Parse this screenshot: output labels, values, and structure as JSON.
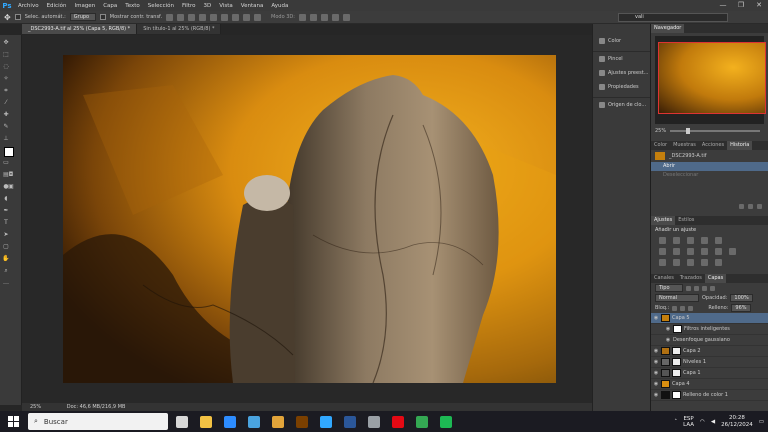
{
  "app": {
    "logo": "Ps"
  },
  "menu": [
    "Archivo",
    "Edición",
    "Imagen",
    "Capa",
    "Texto",
    "Selección",
    "Filtro",
    "3D",
    "Vista",
    "Ventana",
    "Ayuda"
  ],
  "window_controls": {
    "minimize": "—",
    "maximize": "❐",
    "close": "✕"
  },
  "options_bar": {
    "auto_select_label": "Selec. automát.:",
    "auto_select_value": "Grupo",
    "transform_label": "Mostrar contr. transf.",
    "mode3d_label": "Modo 3D:",
    "search_value": "vali"
  },
  "doc_tabs": [
    {
      "label": "_DSC2993-A.tif al 25% (Capa 5, RGB/8) *",
      "active": true
    },
    {
      "label": "Sin título-1 al 25% (RGB/8) *",
      "active": false
    }
  ],
  "mid_panel": [
    {
      "icon": "color-cube-icon",
      "label": "Color"
    },
    {
      "icon": "brush-icon",
      "label": "Pincel"
    },
    {
      "icon": "brush-presets-icon",
      "label": "Ajustes preest..."
    },
    {
      "icon": "properties-icon",
      "label": "Propiedades"
    },
    {
      "icon": "clone-source-icon",
      "label": "Origen de clo..."
    }
  ],
  "navigator": {
    "tab": "Navegador",
    "zoom": "25%"
  },
  "history_tabs": [
    "Color",
    "Muestras",
    "Acciones",
    "Historia"
  ],
  "history": {
    "snapshot": "_DSC2993-A.tif",
    "items": [
      {
        "label": "Abrir",
        "state": "selected"
      },
      {
        "label": "Deseleccionar",
        "state": "disabled"
      }
    ]
  },
  "adjustments": {
    "tabs": [
      "Ajustes",
      "Estilos"
    ],
    "title": "Añadir un ajuste"
  },
  "layers": {
    "tabs": [
      "Canales",
      "Trazados",
      "Capas"
    ],
    "kind": "Tipo",
    "blend": "Normal",
    "opacity_label": "Opacidad:",
    "opacity": "100%",
    "lock_label": "Bloq.:",
    "fill_label": "Relleno:",
    "fill": "96%",
    "items": [
      {
        "name": "Capa 5",
        "selected": true
      },
      {
        "name": "Filtros inteligentes",
        "sub": true
      },
      {
        "name": "Desenfoque gaussiano",
        "sub": true
      },
      {
        "name": "Capa 2"
      },
      {
        "name": "Niveles 1"
      },
      {
        "name": "Capa 1"
      },
      {
        "name": "Capa 4"
      },
      {
        "name": "Relleno de color 1"
      }
    ]
  },
  "status_bar": {
    "zoom": "25%",
    "doc": "Doc: 46,6 MB/216,9 MB"
  },
  "taskbar": {
    "search_placeholder": "Buscar",
    "apps": [
      {
        "icon": "task-view-icon",
        "color": "#d8d8d8"
      },
      {
        "icon": "file-explorer-icon",
        "color": "#f3c244"
      },
      {
        "icon": "zoom-icon",
        "color": "#2d8cff"
      },
      {
        "icon": "store-icon",
        "color": "#4aa3df"
      },
      {
        "icon": "bridge-icon",
        "color": "#e2a43a"
      },
      {
        "icon": "illustrator-icon",
        "color": "#7a3f00"
      },
      {
        "icon": "photoshop-icon",
        "color": "#31a8ff"
      },
      {
        "icon": "word-icon",
        "color": "#2b579a"
      },
      {
        "icon": "maps-icon",
        "color": "#9aa0a6"
      },
      {
        "icon": "netflix-icon",
        "color": "#e50914"
      },
      {
        "icon": "chrome-icon",
        "color": "#34a853"
      },
      {
        "icon": "spotify-icon",
        "color": "#1db954"
      }
    ]
  },
  "tray": {
    "lang_top": "ESP",
    "lang_bottom": "LAA",
    "time": "20:28",
    "date": "26/12/2024"
  }
}
